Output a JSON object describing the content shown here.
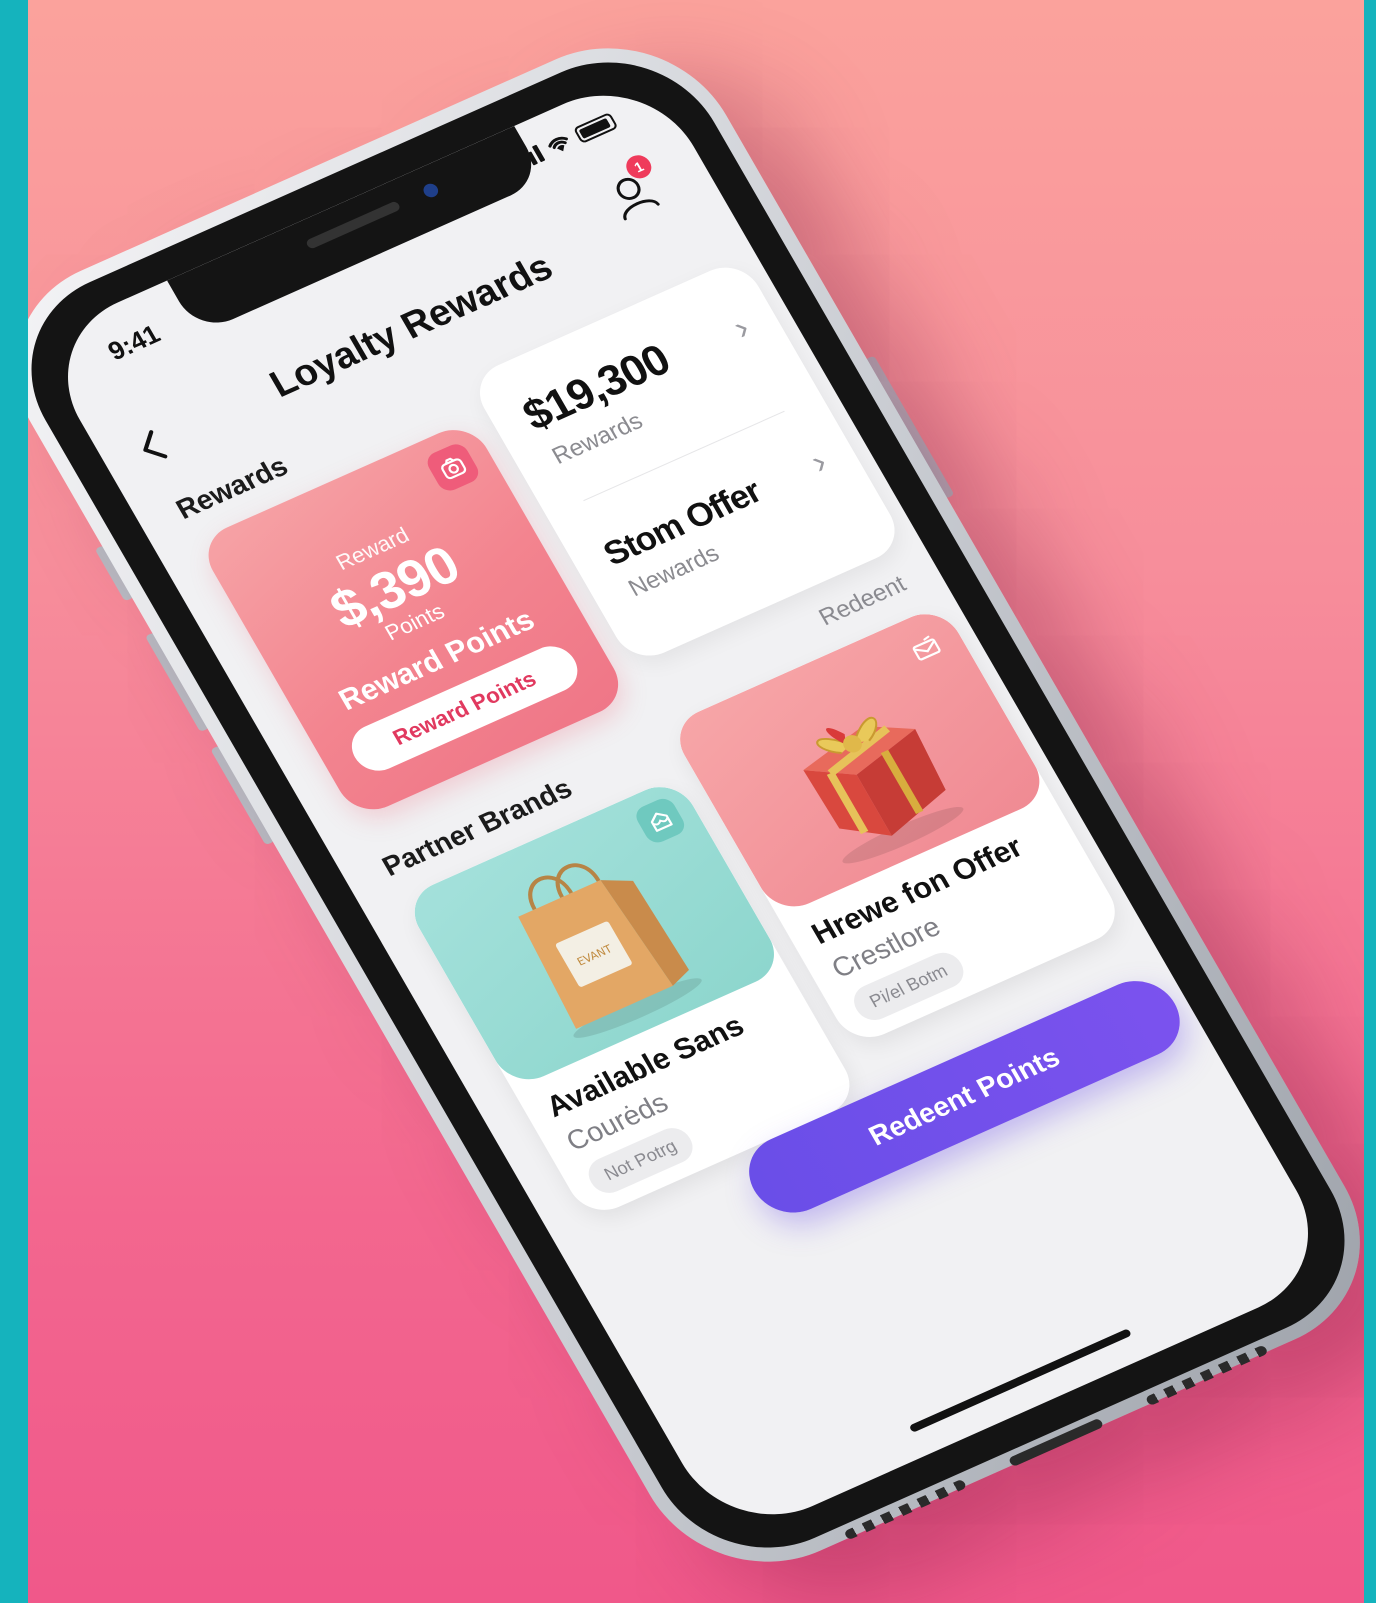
{
  "status_bar": {
    "time": "9:41"
  },
  "header": {
    "title": "Loyalty Rewards",
    "notification_count": "1"
  },
  "rewards_section": {
    "label": "Rewards"
  },
  "reward_card": {
    "label": "Reward",
    "value": "$,390",
    "unit": "Points",
    "subtitle": "Reward Points",
    "button_label": "Reward Points"
  },
  "summary": {
    "rows": [
      {
        "main": "$19,300",
        "sub": "Rewards"
      },
      {
        "main": "Stom Offer",
        "sub": "Newards"
      }
    ]
  },
  "redeem_link": "Redeent",
  "partner_section": {
    "label": "Partner Brands"
  },
  "brands": [
    {
      "title": "Available Sans",
      "subtitle": "Courėds",
      "tag": "Not Potrg",
      "bag_logo": "EVANT"
    },
    {
      "title": "Hrewe fon Offer",
      "subtitle": "Crestlore",
      "tag": "Pi/el Botm"
    }
  ],
  "cta": {
    "label": "Redeent Points"
  },
  "colors": {
    "outer_frame": "#15b3bd",
    "background_top": "#fba29c",
    "background_bottom": "#f0588a",
    "reward_card": "#f3848f",
    "teal_card": "#8dd6cd",
    "pink_card": "#f08a93",
    "cta": "#6a4ee8"
  },
  "icons": [
    "back-chevron-icon",
    "profile-icon",
    "camera-icon",
    "chevron-right-icon",
    "store-icon",
    "mail-icon",
    "signal-icon",
    "wifi-icon",
    "battery-icon"
  ]
}
